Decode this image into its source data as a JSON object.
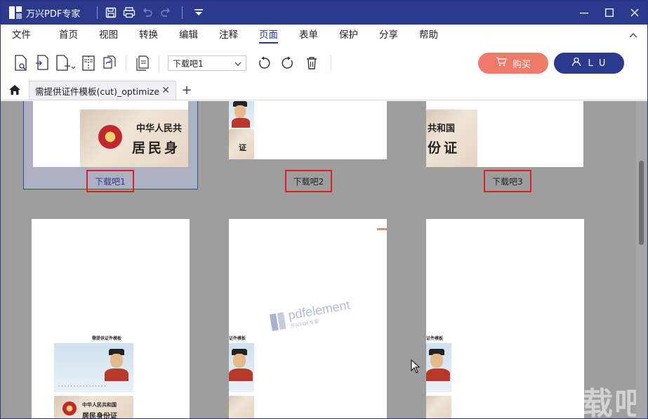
{
  "app": {
    "title": "万兴PDF专家",
    "colors": {
      "titlebar": "#2b3a8d",
      "accent": "#2b3a8d",
      "buy": "#f07a6a",
      "highlight": "#e02020"
    }
  },
  "quick_access": [
    "save-icon",
    "print-icon",
    "undo-icon",
    "redo-icon",
    "dropdown-icon"
  ],
  "menu": {
    "items": [
      "文件",
      "首页",
      "视图",
      "转换",
      "编辑",
      "注释",
      "页面",
      "表单",
      "保护",
      "分享",
      "帮助"
    ],
    "active": "页面"
  },
  "toolbar": {
    "page_select_value": "下载吧1",
    "buy_label": "购买",
    "user_label": "L U"
  },
  "tabs": {
    "doc_title": "需提供证件模板(cut)_optimize"
  },
  "pages": {
    "row1": [
      {
        "label": "下载吧1",
        "selected": true
      },
      {
        "label": "下载吧2",
        "selected": false
      },
      {
        "label": "下载吧3",
        "selected": false
      }
    ],
    "card_texts": {
      "p1_line1": "中华人民共",
      "p1_line2": "居民身",
      "p2_line1": "证",
      "p3_line1": "共和国",
      "p3_line2": "份证",
      "doc_heading": "需提供证件模板",
      "doc_heading_cut": "证件模板",
      "card_small_line1": "中华人民共和国",
      "card_small_line2": "居民身份证"
    }
  },
  "watermark": {
    "brand": "pdfelement",
    "sub": "万兴PDF专家"
  },
  "site_watermark": "下载吧"
}
